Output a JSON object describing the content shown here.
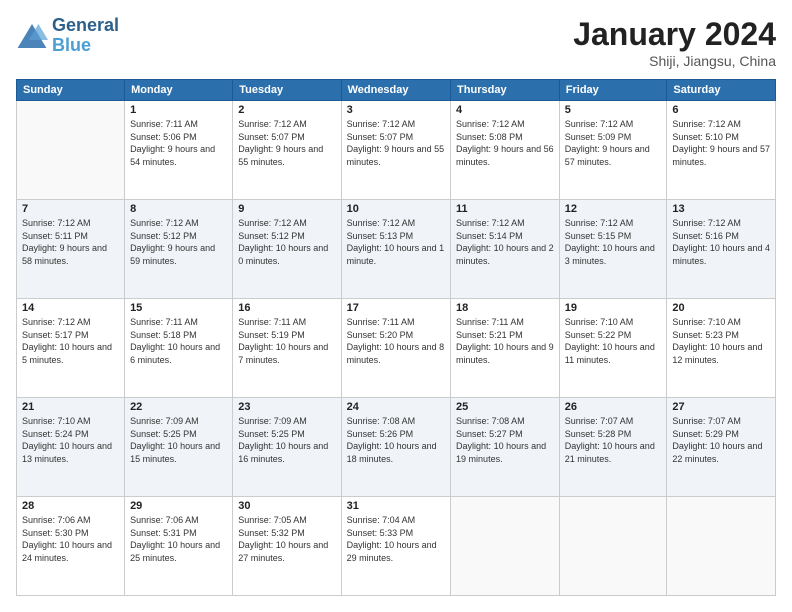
{
  "header": {
    "logo_line1": "General",
    "logo_line2": "Blue",
    "month": "January 2024",
    "location": "Shiji, Jiangsu, China"
  },
  "days_of_week": [
    "Sunday",
    "Monday",
    "Tuesday",
    "Wednesday",
    "Thursday",
    "Friday",
    "Saturday"
  ],
  "weeks": [
    [
      {
        "day": "",
        "sunrise": "",
        "sunset": "",
        "daylight": "",
        "empty": true
      },
      {
        "day": "1",
        "sunrise": "Sunrise: 7:11 AM",
        "sunset": "Sunset: 5:06 PM",
        "daylight": "Daylight: 9 hours and 54 minutes."
      },
      {
        "day": "2",
        "sunrise": "Sunrise: 7:12 AM",
        "sunset": "Sunset: 5:07 PM",
        "daylight": "Daylight: 9 hours and 55 minutes."
      },
      {
        "day": "3",
        "sunrise": "Sunrise: 7:12 AM",
        "sunset": "Sunset: 5:07 PM",
        "daylight": "Daylight: 9 hours and 55 minutes."
      },
      {
        "day": "4",
        "sunrise": "Sunrise: 7:12 AM",
        "sunset": "Sunset: 5:08 PM",
        "daylight": "Daylight: 9 hours and 56 minutes."
      },
      {
        "day": "5",
        "sunrise": "Sunrise: 7:12 AM",
        "sunset": "Sunset: 5:09 PM",
        "daylight": "Daylight: 9 hours and 57 minutes."
      },
      {
        "day": "6",
        "sunrise": "Sunrise: 7:12 AM",
        "sunset": "Sunset: 5:10 PM",
        "daylight": "Daylight: 9 hours and 57 minutes."
      }
    ],
    [
      {
        "day": "7",
        "sunrise": "Sunrise: 7:12 AM",
        "sunset": "Sunset: 5:11 PM",
        "daylight": "Daylight: 9 hours and 58 minutes."
      },
      {
        "day": "8",
        "sunrise": "Sunrise: 7:12 AM",
        "sunset": "Sunset: 5:12 PM",
        "daylight": "Daylight: 9 hours and 59 minutes."
      },
      {
        "day": "9",
        "sunrise": "Sunrise: 7:12 AM",
        "sunset": "Sunset: 5:12 PM",
        "daylight": "Daylight: 10 hours and 0 minutes."
      },
      {
        "day": "10",
        "sunrise": "Sunrise: 7:12 AM",
        "sunset": "Sunset: 5:13 PM",
        "daylight": "Daylight: 10 hours and 1 minute."
      },
      {
        "day": "11",
        "sunrise": "Sunrise: 7:12 AM",
        "sunset": "Sunset: 5:14 PM",
        "daylight": "Daylight: 10 hours and 2 minutes."
      },
      {
        "day": "12",
        "sunrise": "Sunrise: 7:12 AM",
        "sunset": "Sunset: 5:15 PM",
        "daylight": "Daylight: 10 hours and 3 minutes."
      },
      {
        "day": "13",
        "sunrise": "Sunrise: 7:12 AM",
        "sunset": "Sunset: 5:16 PM",
        "daylight": "Daylight: 10 hours and 4 minutes."
      }
    ],
    [
      {
        "day": "14",
        "sunrise": "Sunrise: 7:12 AM",
        "sunset": "Sunset: 5:17 PM",
        "daylight": "Daylight: 10 hours and 5 minutes."
      },
      {
        "day": "15",
        "sunrise": "Sunrise: 7:11 AM",
        "sunset": "Sunset: 5:18 PM",
        "daylight": "Daylight: 10 hours and 6 minutes."
      },
      {
        "day": "16",
        "sunrise": "Sunrise: 7:11 AM",
        "sunset": "Sunset: 5:19 PM",
        "daylight": "Daylight: 10 hours and 7 minutes."
      },
      {
        "day": "17",
        "sunrise": "Sunrise: 7:11 AM",
        "sunset": "Sunset: 5:20 PM",
        "daylight": "Daylight: 10 hours and 8 minutes."
      },
      {
        "day": "18",
        "sunrise": "Sunrise: 7:11 AM",
        "sunset": "Sunset: 5:21 PM",
        "daylight": "Daylight: 10 hours and 9 minutes."
      },
      {
        "day": "19",
        "sunrise": "Sunrise: 7:10 AM",
        "sunset": "Sunset: 5:22 PM",
        "daylight": "Daylight: 10 hours and 11 minutes."
      },
      {
        "day": "20",
        "sunrise": "Sunrise: 7:10 AM",
        "sunset": "Sunset: 5:23 PM",
        "daylight": "Daylight: 10 hours and 12 minutes."
      }
    ],
    [
      {
        "day": "21",
        "sunrise": "Sunrise: 7:10 AM",
        "sunset": "Sunset: 5:24 PM",
        "daylight": "Daylight: 10 hours and 13 minutes."
      },
      {
        "day": "22",
        "sunrise": "Sunrise: 7:09 AM",
        "sunset": "Sunset: 5:25 PM",
        "daylight": "Daylight: 10 hours and 15 minutes."
      },
      {
        "day": "23",
        "sunrise": "Sunrise: 7:09 AM",
        "sunset": "Sunset: 5:25 PM",
        "daylight": "Daylight: 10 hours and 16 minutes."
      },
      {
        "day": "24",
        "sunrise": "Sunrise: 7:08 AM",
        "sunset": "Sunset: 5:26 PM",
        "daylight": "Daylight: 10 hours and 18 minutes."
      },
      {
        "day": "25",
        "sunrise": "Sunrise: 7:08 AM",
        "sunset": "Sunset: 5:27 PM",
        "daylight": "Daylight: 10 hours and 19 minutes."
      },
      {
        "day": "26",
        "sunrise": "Sunrise: 7:07 AM",
        "sunset": "Sunset: 5:28 PM",
        "daylight": "Daylight: 10 hours and 21 minutes."
      },
      {
        "day": "27",
        "sunrise": "Sunrise: 7:07 AM",
        "sunset": "Sunset: 5:29 PM",
        "daylight": "Daylight: 10 hours and 22 minutes."
      }
    ],
    [
      {
        "day": "28",
        "sunrise": "Sunrise: 7:06 AM",
        "sunset": "Sunset: 5:30 PM",
        "daylight": "Daylight: 10 hours and 24 minutes."
      },
      {
        "day": "29",
        "sunrise": "Sunrise: 7:06 AM",
        "sunset": "Sunset: 5:31 PM",
        "daylight": "Daylight: 10 hours and 25 minutes."
      },
      {
        "day": "30",
        "sunrise": "Sunrise: 7:05 AM",
        "sunset": "Sunset: 5:32 PM",
        "daylight": "Daylight: 10 hours and 27 minutes."
      },
      {
        "day": "31",
        "sunrise": "Sunrise: 7:04 AM",
        "sunset": "Sunset: 5:33 PM",
        "daylight": "Daylight: 10 hours and 29 minutes."
      },
      {
        "day": "",
        "sunrise": "",
        "sunset": "",
        "daylight": "",
        "empty": true
      },
      {
        "day": "",
        "sunrise": "",
        "sunset": "",
        "daylight": "",
        "empty": true
      },
      {
        "day": "",
        "sunrise": "",
        "sunset": "",
        "daylight": "",
        "empty": true
      }
    ]
  ]
}
